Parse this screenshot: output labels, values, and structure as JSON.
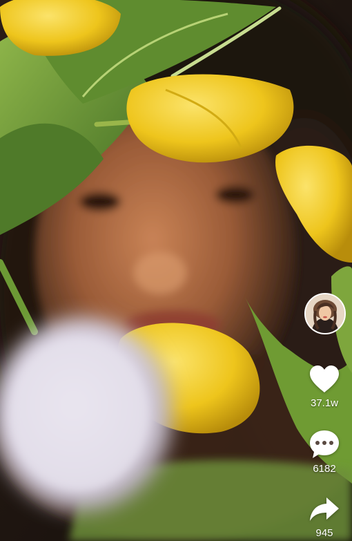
{
  "actions": {
    "likes": "37.1w",
    "comments": "6182",
    "shares": "945"
  },
  "icons": {
    "like": "heart-icon",
    "comment": "comment-bubble-icon",
    "share": "share-arrow-icon"
  },
  "colors": {
    "tulip_yellow": "#f2cf1f",
    "leaf_green": "#6e9a34",
    "skin": "#b5744a",
    "background": "#1b1410",
    "icon_white": "#ffffff"
  }
}
